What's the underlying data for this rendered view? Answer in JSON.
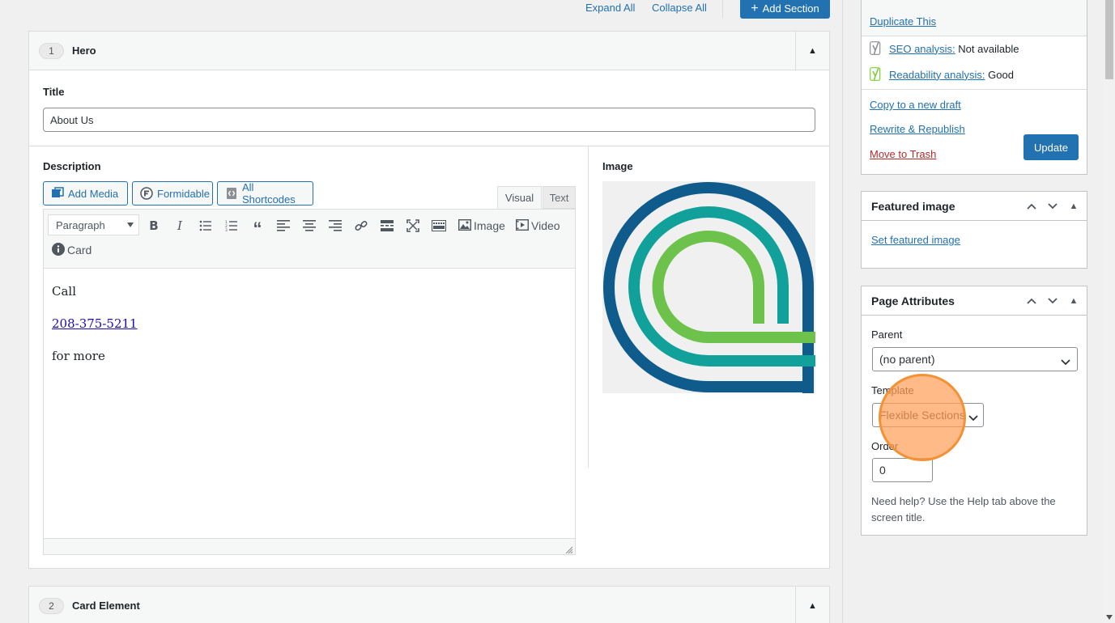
{
  "top_controls": {
    "expand_all": "Expand All",
    "collapse_all": "Collapse All",
    "add_section": "Add Section"
  },
  "section_1": {
    "number": "1",
    "title": "Hero",
    "title_label": "Title",
    "title_value": "About Us",
    "description_label": "Description",
    "image_label": "Image",
    "media_buttons": {
      "add_media": "Add Media",
      "formidable": "Formidable",
      "all_shortcodes": "All Shortcodes"
    },
    "editor_tabs": {
      "visual": "Visual",
      "text": "Text"
    },
    "toolbar": {
      "format_select": "Paragraph",
      "image": "Image",
      "video": "Video",
      "card": "Card"
    },
    "content": {
      "line1": "Call",
      "phone": "208-375-5211",
      "line3": "for more"
    },
    "logo_colors": {
      "outer": "#0e5b8c",
      "middle": "#11a19a",
      "inner": "#6cc24a",
      "background": "#f0f0f1"
    }
  },
  "section_2": {
    "number": "2",
    "title": "Card Element"
  },
  "publish_box": {
    "duplicate": "Duplicate This",
    "seo_label": "SEO analysis:",
    "seo_value": "Not available",
    "readability_label": "Readability analysis:",
    "readability_value": "Good",
    "copy_draft": "Copy to a new draft",
    "rewrite": "Rewrite & Republish",
    "trash": "Move to Trash",
    "update": "Update"
  },
  "featured_image": {
    "title": "Featured image",
    "set_link": "Set featured image"
  },
  "page_attributes": {
    "title": "Page Attributes",
    "parent_label": "Parent",
    "parent_value": "(no parent)",
    "template_label": "Template",
    "template_value": "Flexible Sections",
    "order_label": "Order",
    "order_value": "0",
    "help_text": "Need help? Use the Help tab above the screen title."
  },
  "colors": {
    "primary": "#2271b1",
    "danger": "#b32d2e",
    "cursor_highlight": "#f29234"
  }
}
